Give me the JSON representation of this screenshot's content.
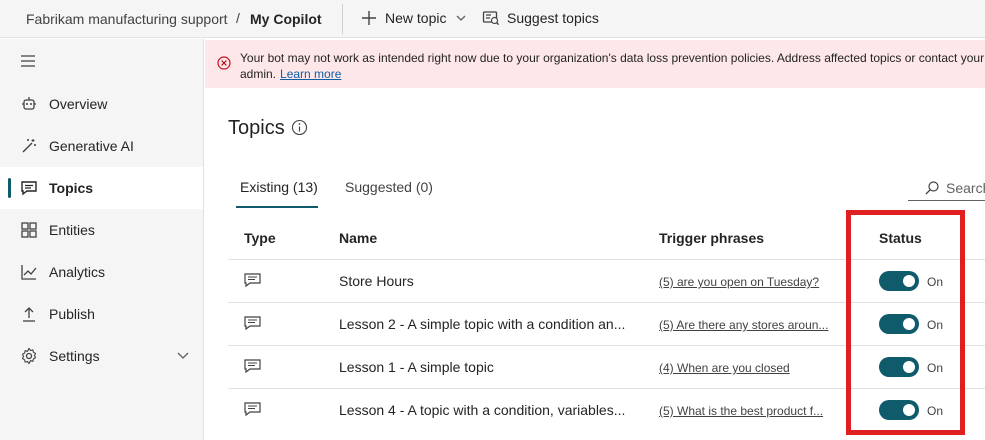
{
  "header": {
    "org": "Fabrikam manufacturing support",
    "separator": "/",
    "bot_name": "My Copilot",
    "new_topic_label": "New topic",
    "suggest_topics_label": "Suggest topics"
  },
  "sidebar": {
    "items": [
      {
        "label": "Overview",
        "icon": "overview-icon"
      },
      {
        "label": "Generative AI",
        "icon": "wand-icon"
      },
      {
        "label": "Topics",
        "icon": "chat-icon",
        "active": true
      },
      {
        "label": "Entities",
        "icon": "entities-icon"
      },
      {
        "label": "Analytics",
        "icon": "chart-icon"
      },
      {
        "label": "Publish",
        "icon": "upload-icon"
      },
      {
        "label": "Settings",
        "icon": "gear-icon"
      }
    ]
  },
  "banner": {
    "message": "Your bot may not work as intended right now due to your organization's data loss prevention policies. Address affected topics or contact your admin.",
    "link": "Learn more"
  },
  "main": {
    "title": "Topics",
    "tabs": [
      {
        "label": "Existing (13)",
        "selected": true
      },
      {
        "label": "Suggested (0)",
        "selected": false
      }
    ],
    "search_placeholder": "Search",
    "columns": {
      "type": "Type",
      "name": "Name",
      "trigger": "Trigger phrases",
      "status": "Status"
    },
    "rows": [
      {
        "name": "Store Hours",
        "trigger": "(5) are you open on Tuesday?",
        "status": "On"
      },
      {
        "name": "Lesson 2 - A simple topic with a condition an...",
        "trigger": "(5) Are there any stores aroun...",
        "status": "On"
      },
      {
        "name": "Lesson 1 - A simple topic",
        "trigger": "(4) When are you closed",
        "status": "On"
      },
      {
        "name": "Lesson 4 - A topic with a condition, variables...",
        "trigger": "(5) What is the best product f...",
        "status": "On"
      }
    ]
  },
  "colors": {
    "accent": "#0f5a6b",
    "banner_bg": "#fde7e9",
    "highlight": "#e02020"
  }
}
